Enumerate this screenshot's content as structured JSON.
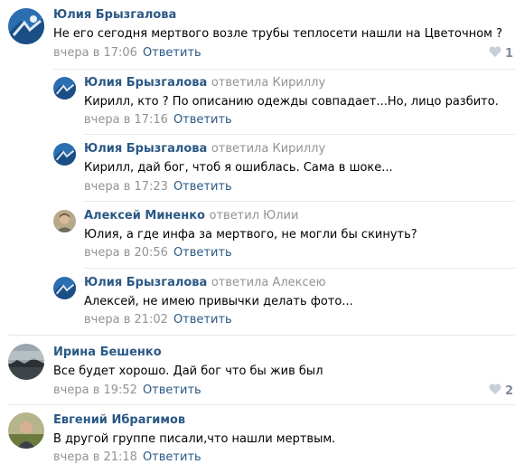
{
  "comments": [
    {
      "author": "Юлия Брызгалова",
      "text": "Не его сегодня мертвого возле трубы теплосети нашли на Цветочном ?",
      "time": "вчера в 17:06",
      "reply_label": "Ответить",
      "likes": "1",
      "replies": [
        {
          "author": "Юлия Брызгалова",
          "replied_to": "ответила Кириллу",
          "text": "Кирилл, кто ? По описанию одежды совпадает...Но, лицо разбито.",
          "time": "вчера в 17:16",
          "reply_label": "Ответить"
        },
        {
          "author": "Юлия Брызгалова",
          "replied_to": "ответила Кириллу",
          "text": "Кирилл, дай бог, чтоб я ошиблась. Сама в шоке...",
          "time": "вчера в 17:23",
          "reply_label": "Ответить"
        },
        {
          "author": "Алексей Миненко",
          "replied_to": "ответил Юлии",
          "text": "Юлия, а где инфа за мертвого, не могли бы скинуть?",
          "time": "вчера в 20:56",
          "reply_label": "Ответить"
        },
        {
          "author": "Юлия Брызгалова",
          "replied_to": "ответила Алексею",
          "text": "Алексей, не имею привычки делать фото...",
          "time": "вчера в 21:02",
          "reply_label": "Ответить"
        }
      ]
    },
    {
      "author": "Ирина Бешенко",
      "text": "Все будет хорошо. Дай бог что бы жив был",
      "time": "вчера в 19:52",
      "reply_label": "Ответить",
      "likes": "2"
    },
    {
      "author": "Евгений Ибрагимов",
      "text": "В другой группе писали,что нашли мертвым.",
      "time": "вчера в 21:18",
      "reply_label": "Ответить"
    }
  ],
  "icons": {
    "like": "heart-icon"
  },
  "colors": {
    "link": "#2a5885",
    "meta": "#939393",
    "divider": "#e7e8ec"
  }
}
